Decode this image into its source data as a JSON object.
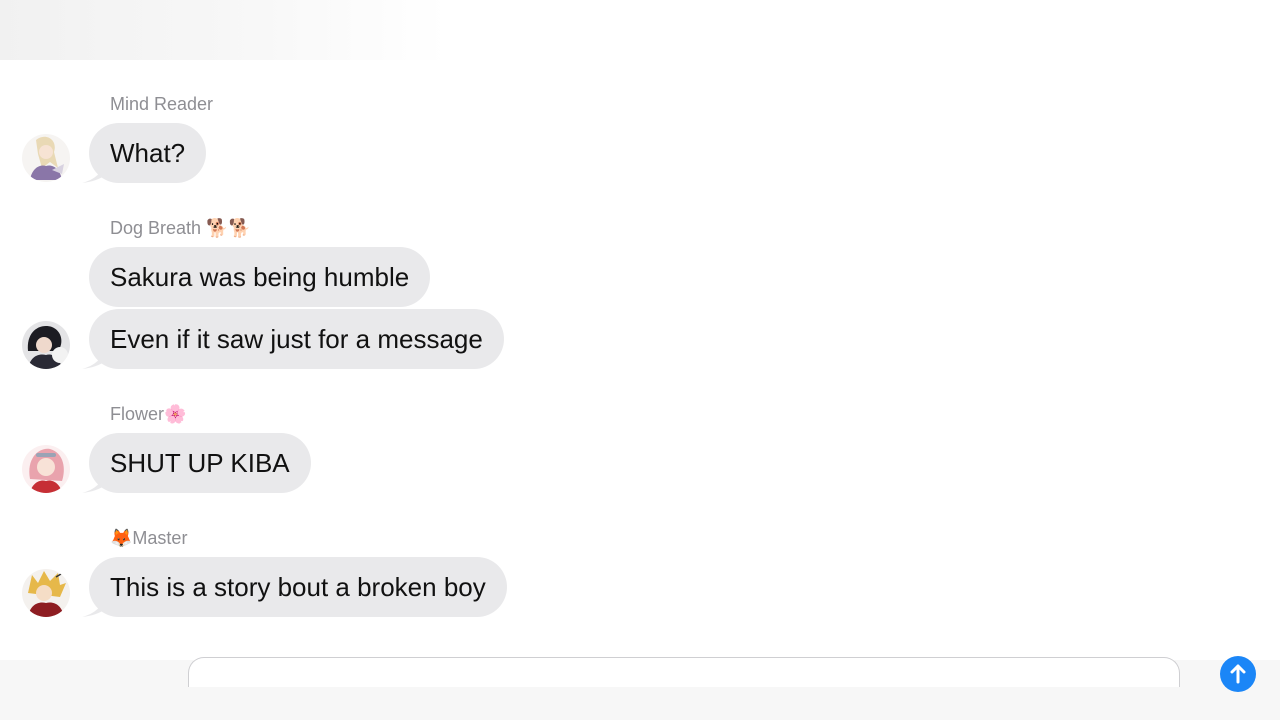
{
  "conversation": {
    "groups": [
      {
        "sender": "Mind Reader",
        "messages": [
          "What?"
        ],
        "avatar": "blonde-character-avatar"
      },
      {
        "sender": "Dog Breath",
        "sender_emoji": "🐕🐕",
        "messages": [
          "Sakura was being humble",
          "Even if it saw just for a message"
        ],
        "avatar": "dark-haired-character-avatar"
      },
      {
        "sender": "Flower",
        "sender_emoji": "🌸",
        "messages": [
          "SHUT UP KIBA"
        ],
        "avatar": "pink-haired-character-avatar"
      },
      {
        "sender": "Master",
        "sender_emoji_prefix": "🦊",
        "messages": [
          "This is a story bout a broken boy"
        ],
        "avatar": "blond-character-avatar"
      }
    ]
  },
  "colors": {
    "bubble": "#e9e9eb",
    "sender_label": "#8e8e93",
    "send_button": "#1b86f7"
  }
}
